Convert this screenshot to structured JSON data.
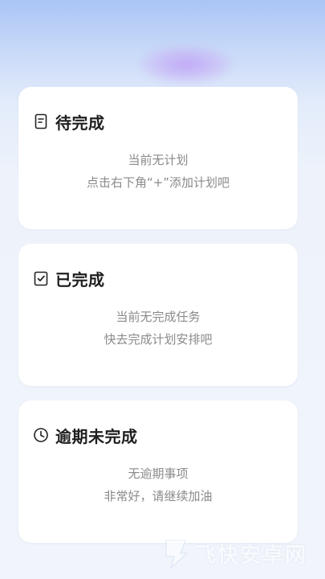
{
  "sections": [
    {
      "title": "待完成",
      "icon": "document-icon",
      "empty_line1": "当前无计划",
      "empty_line2": "点击右下角“+”添加计划吧"
    },
    {
      "title": "已完成",
      "icon": "checkbox-icon",
      "empty_line1": "当前无完成任务",
      "empty_line2": "快去完成计划安排吧"
    },
    {
      "title": "逾期未完成",
      "icon": "clock-icon",
      "empty_line1": "无逾期事项",
      "empty_line2": "非常好，请继续加油"
    }
  ],
  "watermark": {
    "text": "飞快安卓网"
  },
  "colors": {
    "title": "#1f1f1f",
    "empty_text": "#8a8a8a",
    "card_bg": "#ffffff",
    "background_top": "#a9c4f5"
  }
}
